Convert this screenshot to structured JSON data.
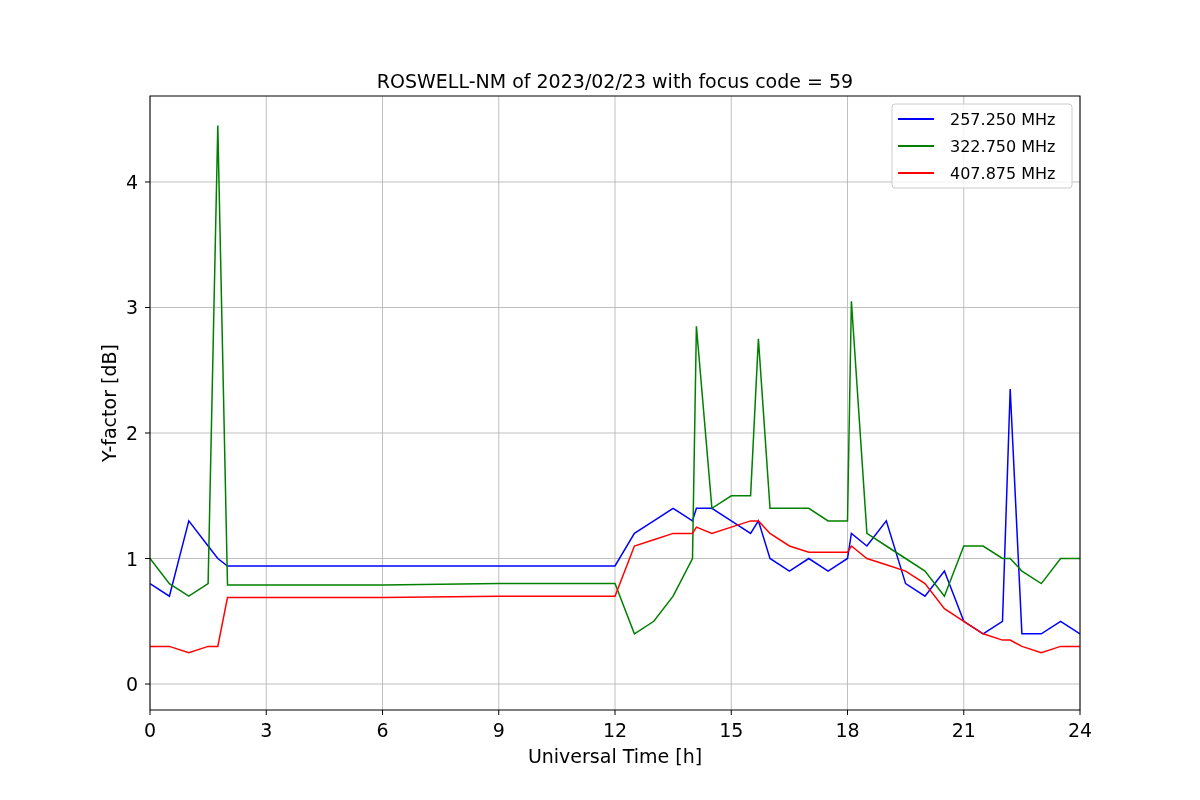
{
  "figure": {
    "chart_data": {
      "type": "line",
      "title": "ROSWELL-NM of 2023/02/23 with focus code = 59",
      "xlabel": "Universal Time [h]",
      "ylabel": "Y-factor [dB]",
      "x": [
        0,
        0.5,
        1,
        1.5,
        1.75,
        2,
        3,
        6,
        9,
        12,
        12.5,
        13,
        13.5,
        14,
        14.1,
        14.5,
        15,
        15.5,
        15.7,
        16,
        16.5,
        17,
        17.5,
        18,
        18.1,
        18.5,
        19,
        19.5,
        20,
        20.5,
        21,
        21.5,
        22,
        22.2,
        22.5,
        23,
        23.5,
        24
      ],
      "series": [
        {
          "name": "257.250 MHz",
          "color": "#0000ff",
          "values": [
            0.8,
            0.7,
            1.3,
            1.1,
            1.0,
            0.94,
            0.94,
            0.94,
            0.94,
            0.94,
            1.2,
            1.3,
            1.4,
            1.3,
            1.4,
            1.4,
            1.3,
            1.2,
            1.3,
            1.0,
            0.9,
            1.0,
            0.9,
            1.0,
            1.2,
            1.1,
            1.3,
            0.8,
            0.7,
            0.9,
            0.5,
            0.4,
            0.5,
            2.35,
            0.4,
            0.4,
            0.5,
            0.4
          ]
        },
        {
          "name": "322.750 MHz",
          "color": "#008000",
          "values": [
            1.0,
            0.8,
            0.7,
            0.8,
            4.45,
            0.79,
            0.79,
            0.79,
            0.8,
            0.8,
            0.4,
            0.5,
            0.7,
            1.0,
            2.85,
            1.4,
            1.5,
            1.5,
            2.75,
            1.4,
            1.4,
            1.4,
            1.3,
            1.3,
            3.05,
            1.2,
            1.1,
            1.0,
            0.9,
            0.7,
            1.1,
            1.1,
            1.0,
            1.0,
            0.9,
            0.8,
            1.0,
            1.0
          ]
        },
        {
          "name": "407.875 MHz",
          "color": "#ff0000",
          "values": [
            0.3,
            0.3,
            0.25,
            0.3,
            0.3,
            0.69,
            0.69,
            0.69,
            0.7,
            0.7,
            1.1,
            1.15,
            1.2,
            1.2,
            1.25,
            1.2,
            1.25,
            1.3,
            1.3,
            1.2,
            1.1,
            1.05,
            1.05,
            1.05,
            1.1,
            1.0,
            0.95,
            0.9,
            0.8,
            0.6,
            0.5,
            0.4,
            0.35,
            0.35,
            0.3,
            0.25,
            0.3,
            0.3
          ]
        }
      ],
      "grid": true,
      "legend": true,
      "xlim": [
        0,
        24
      ],
      "ylim": [
        -0.207,
        4.685
      ],
      "xticks": [
        0,
        3,
        6,
        9,
        12,
        15,
        18,
        21,
        24
      ],
      "yticks": [
        0,
        1,
        2,
        3,
        4
      ]
    }
  }
}
